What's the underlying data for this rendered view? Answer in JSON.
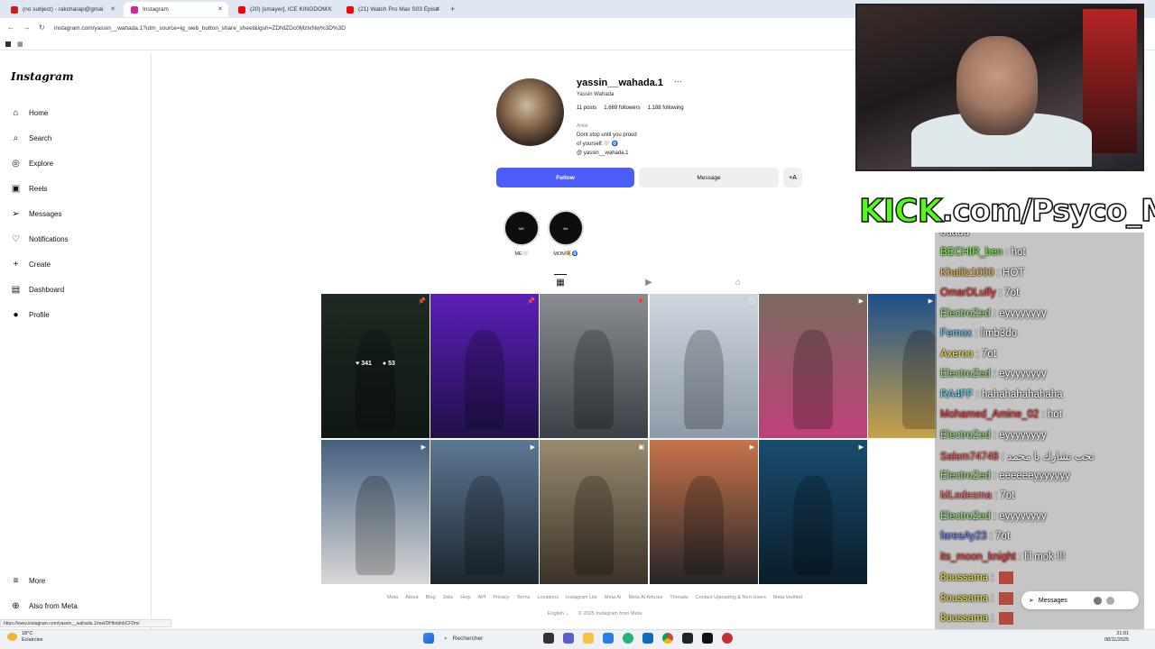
{
  "browser": {
    "tabs": [
      {
        "label": "(no subject) - rakcharap@gmai",
        "active": false,
        "color": "#c5221f"
      },
      {
        "label": "Instagram",
        "active": true,
        "color": "#d6249f"
      },
      {
        "label": "(20) [smayer], ICE KINGDOM...",
        "active": false,
        "color": "#ff0000"
      },
      {
        "label": "(21) Watch Pro Max S03 Episo",
        "active": false,
        "color": "#ff0000"
      }
    ],
    "url": "instagram.com/yassin__wahada.1?utm_source=ig_web_button_share_sheet&igsh=ZDNlZDc0MzIxNw%3D%3D",
    "status_url": "https://www.instagram.com/yassin__wahada.1/reel/DHbnbhbCFDm/"
  },
  "sidebar": {
    "logo": "Instagram",
    "items": [
      {
        "label": "Home",
        "icon": "home-icon",
        "glyph": "⌂"
      },
      {
        "label": "Search",
        "icon": "search-icon",
        "glyph": "⌕"
      },
      {
        "label": "Explore",
        "icon": "compass-icon",
        "glyph": "◎"
      },
      {
        "label": "Reels",
        "icon": "reels-icon",
        "glyph": "▣"
      },
      {
        "label": "Messages",
        "icon": "messages-icon",
        "glyph": "➢"
      },
      {
        "label": "Notifications",
        "icon": "heart-icon",
        "glyph": "♡"
      },
      {
        "label": "Create",
        "icon": "plus-icon",
        "glyph": "+"
      },
      {
        "label": "Dashboard",
        "icon": "dashboard-icon",
        "glyph": "▤"
      },
      {
        "label": "Profile",
        "icon": "profile-avatar-icon",
        "glyph": "●"
      }
    ],
    "more": {
      "label": "More",
      "glyph": "≡"
    },
    "also_from_meta": {
      "label": "Also from Meta",
      "glyph": "⊕"
    }
  },
  "profile": {
    "username": "yassin__wahada.1",
    "more": "···",
    "full_name": "Yassin Wahada",
    "stats": {
      "posts": "11 posts",
      "followers": "1,669 followers",
      "following": "1,188 following"
    },
    "category": "Artist",
    "bio_line1": "Dont stop until you proud",
    "bio_line2": "of yourself.🤍 🧿",
    "threads": "@ yassin__wahada.1",
    "follow_label": "Follow",
    "message_label": "Message",
    "suggest_label": "+A",
    "highlights": [
      {
        "label": "ME🤍"
      },
      {
        "label": "MOM💐🧿"
      }
    ]
  },
  "profile_tabs": [
    {
      "name": "tab-posts",
      "glyph": "▦",
      "icon": "grid-icon"
    },
    {
      "name": "tab-reels",
      "glyph": "▶",
      "icon": "reels-icon"
    },
    {
      "name": "tab-tagged",
      "glyph": "⌂",
      "icon": "tagged-icon"
    }
  ],
  "posts": [
    {
      "badge": "📌",
      "colors": [
        "#1e2a22",
        "#0f1712"
      ]
    },
    {
      "badge": "📌",
      "colors": [
        "#5b1fb8",
        "#20104a"
      ]
    },
    {
      "badge": "📌",
      "colors": [
        "#8a8e93",
        "#3b4046"
      ]
    },
    {
      "badge": "▢",
      "colors": [
        "#cfd6de",
        "#8e9ba8"
      ]
    },
    {
      "badge": "▶",
      "colors": [
        "#7a6b5e",
        "#c0407a"
      ]
    },
    {
      "badge": "▶",
      "colors": [
        "#1d4f8c",
        "#c8a24a"
      ]
    },
    {
      "badge": "▶",
      "colors": [
        "#44607e",
        "#d8d8d8"
      ]
    },
    {
      "badge": "▶",
      "colors": [
        "#5d7894",
        "#1d2630"
      ]
    },
    {
      "badge": "▣",
      "colors": [
        "#9a8b70",
        "#3a3226"
      ]
    },
    {
      "badge": "▶",
      "colors": [
        "#c8734a",
        "#262629"
      ]
    },
    {
      "badge": "▶",
      "colors": [
        "#1a4c6e",
        "#0b1d2a"
      ]
    }
  ],
  "hover": {
    "likes": "♥ 341",
    "comments": "● 53"
  },
  "footer": {
    "links": [
      "Meta",
      "About",
      "Blog",
      "Jobs",
      "Help",
      "API",
      "Privacy",
      "Terms",
      "Locations",
      "Instagram Lite",
      "Meta AI",
      "Meta AI Articles",
      "Threads",
      "Contact Uploading & Non-Users",
      "Meta Verified"
    ],
    "language": "English ⌄",
    "copyright": "© 2025 Instagram from Meta"
  },
  "overlay": {
    "kick_logo": "KICK",
    "kick_rest": ".com/Psyco_M",
    "chat_top_partial": "ouadu",
    "chat": [
      {
        "user": "BECHIR_ben",
        "color": "#7cfc3a",
        "text": " : hot"
      },
      {
        "user": "Khalilz1000",
        "color": "#f5c242",
        "text": " : HOT"
      },
      {
        "user": "OmarDLuffy",
        "color": "#ff3b3b",
        "text": " : 7ot"
      },
      {
        "user": "ElectroZed",
        "color": "#9be87a",
        "text": " : eyyyyyyyy"
      },
      {
        "user": "Femox",
        "color": "#5fd0ff",
        "text": " : limb3do"
      },
      {
        "user": "Axeroo",
        "color": "#f5e642",
        "text": " : 7ot"
      },
      {
        "user": "ElectroZed",
        "color": "#9be87a",
        "text": " : eyyyyyyyy"
      },
      {
        "user": "RA4FF",
        "color": "#5fe0ff",
        "text": " : hahahahahahaha"
      },
      {
        "user": "Mohamed_Amine_02",
        "color": "#ff3b3b",
        "text": " : hot"
      },
      {
        "user": "ElectroZed",
        "color": "#9be87a",
        "text": " : eyyyyyyyy"
      },
      {
        "user": "Salem74748",
        "color": "#ff5b5b",
        "text": " : نحب نشارك يا محمد"
      },
      {
        "user": "ElectroZed",
        "color": "#9be87a",
        "text": " : eeeeeeyyyyyyy"
      },
      {
        "user": "MLedesma",
        "color": "#ff6b6b",
        "text": " : 7ot"
      },
      {
        "user": "ElectroZed",
        "color": "#9be87a",
        "text": " : eyyyyyyyy"
      },
      {
        "user": "faresAy23",
        "color": "#6f8cff",
        "text": " : 7ot"
      },
      {
        "user": "its_moon_knight",
        "color": "#ff3b3b",
        "text": " : lil mok !!!"
      },
      {
        "user": "8oussama",
        "color": "#f5e642",
        "text": " : "
      },
      {
        "user": "8oussama",
        "color": "#f5e642",
        "text": " : "
      },
      {
        "user": "8oussama",
        "color": "#f5e642",
        "text": " : "
      }
    ],
    "messages_pill": "Messages"
  },
  "taskbar": {
    "weather_temp": "18°C",
    "weather_desc": "Éclaircies",
    "search_label": "Rechercher",
    "time": "21:01",
    "date": "08/11/2025"
  }
}
